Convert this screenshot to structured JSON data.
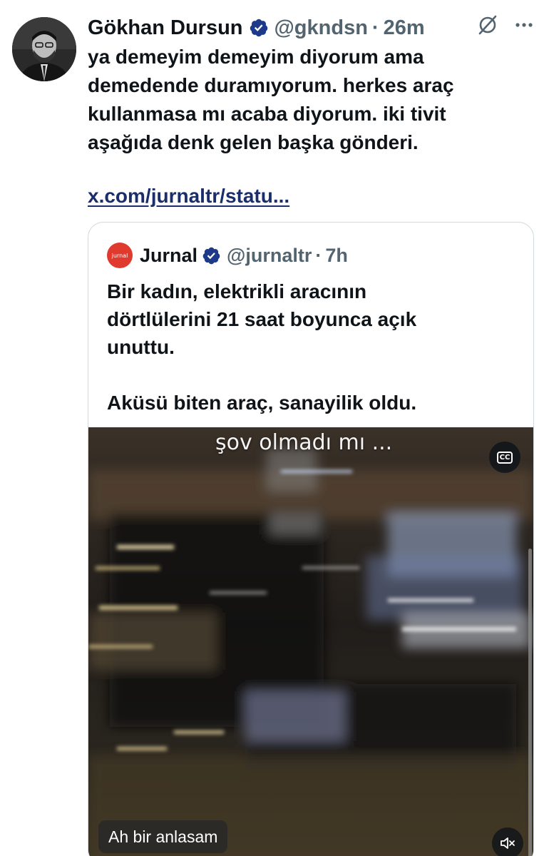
{
  "author": {
    "name": "Gökhan Dursun",
    "handle": "@gkndsn",
    "separator": "·",
    "time": "26m"
  },
  "tweet": {
    "lines": [
      "ya demeyim demeyim diyorum ama",
      "demedende duramıyorum. herkes araç",
      "kullanmasa mı acaba diyorum. iki tivit",
      "aşağıda denk gelen başka gönderi."
    ],
    "link_text": "x.com/jurnaltr/statu..."
  },
  "quoted_tweet": {
    "avatar_text": "jurnal",
    "name": "Jurnal",
    "handle": "@jurnaltr",
    "separator": "·",
    "time": "7h",
    "paragraph1": [
      "Bir kadın, elektrikli aracının",
      "dörtlülerini 21 saat boyunca açık",
      "unuttu."
    ],
    "paragraph2": "Aküsü biten araç, sanayilik oldu."
  },
  "video": {
    "overlay_text": "şov olmadı mı ...",
    "cc_label": "CC",
    "caption": "Ah bir anlasam"
  },
  "icons": {
    "verified": "verified-badge-icon",
    "grok": "grok-icon",
    "more": "more-icon",
    "cc": "closed-captions-icon",
    "mute": "speaker-muted-icon"
  },
  "colors": {
    "verified_blue": "#1d9bf0",
    "link": "#1a2e6b",
    "secondary_text": "#536471",
    "jurnal_red": "#e03a2f"
  }
}
